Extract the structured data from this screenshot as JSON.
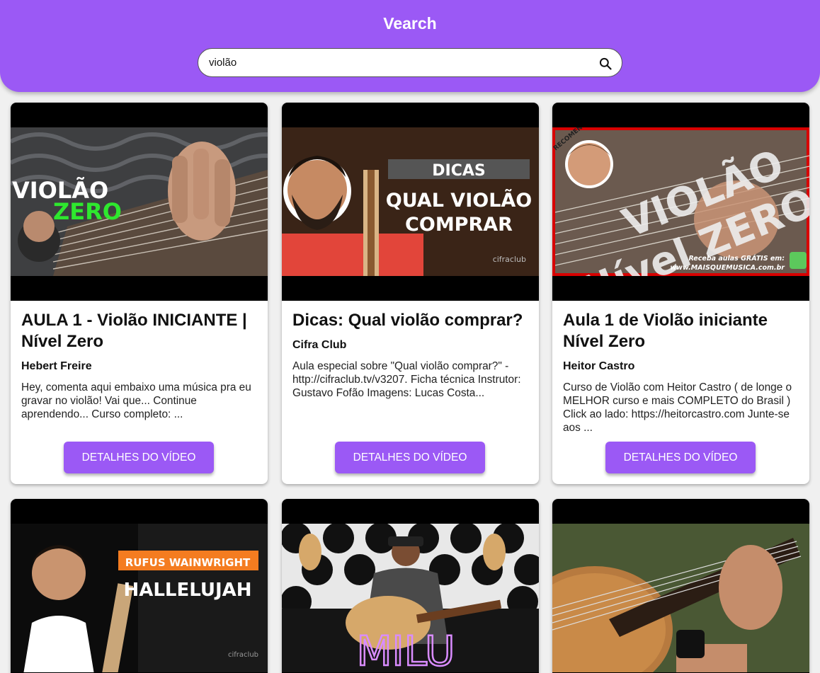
{
  "header": {
    "title": "Vearch"
  },
  "search": {
    "value": "violão",
    "icon": "search-icon"
  },
  "colors": {
    "accent": "#9b59f5",
    "background": "#f0f0f0"
  },
  "videos": [
    {
      "title": "AULA 1 - Violão INICIANTE | Nível Zero",
      "channel": "Hebert Freire",
      "description": "Hey, comenta aqui embaixo uma música pra eu gravar no violão! Vai que... Continue aprendendo... Curso completo: ...",
      "button": "DETALHES DO VÍDEO",
      "thumb_text": [
        "VIOLÃO",
        "ZERO"
      ]
    },
    {
      "title": "Dicas: Qual violão comprar?",
      "channel": "Cifra Club",
      "description": "Aula especial sobre \"Qual violão comprar?\" - http://cifraclub.tv/v3207. Ficha técnica Instrutor: Gustavo Fofão Imagens: Lucas Costa...",
      "button": "DETALHES DO VÍDEO",
      "thumb_text": [
        "DICAS",
        "QUAL VIOLÃO",
        "COMPRAR",
        "cifraclub"
      ]
    },
    {
      "title": "Aula 1 de Violão iniciante Nível Zero",
      "channel": "Heitor Castro",
      "description": "Curso de Violão com Heitor Castro ( de longe o MELHOR curso e mais COMPLETO do Brasil ) Click ao lado: https://heitorcastro.com Junte-se aos ...",
      "button": "DETALHES DO VÍDEO",
      "thumb_text": [
        "VIOLÃO",
        "Nível ZERO",
        "RECOMENDADO",
        "Receba aulas GRÁTIS em:",
        "www.MAISQUEMUSICA.com.br"
      ]
    },
    {
      "thumb_text": [
        "RUFUS WAINWRIGHT",
        "HALLELUJAH",
        "cifraclub"
      ]
    },
    {
      "thumb_text": [
        "MILU"
      ]
    },
    {
      "thumb_text": []
    }
  ]
}
